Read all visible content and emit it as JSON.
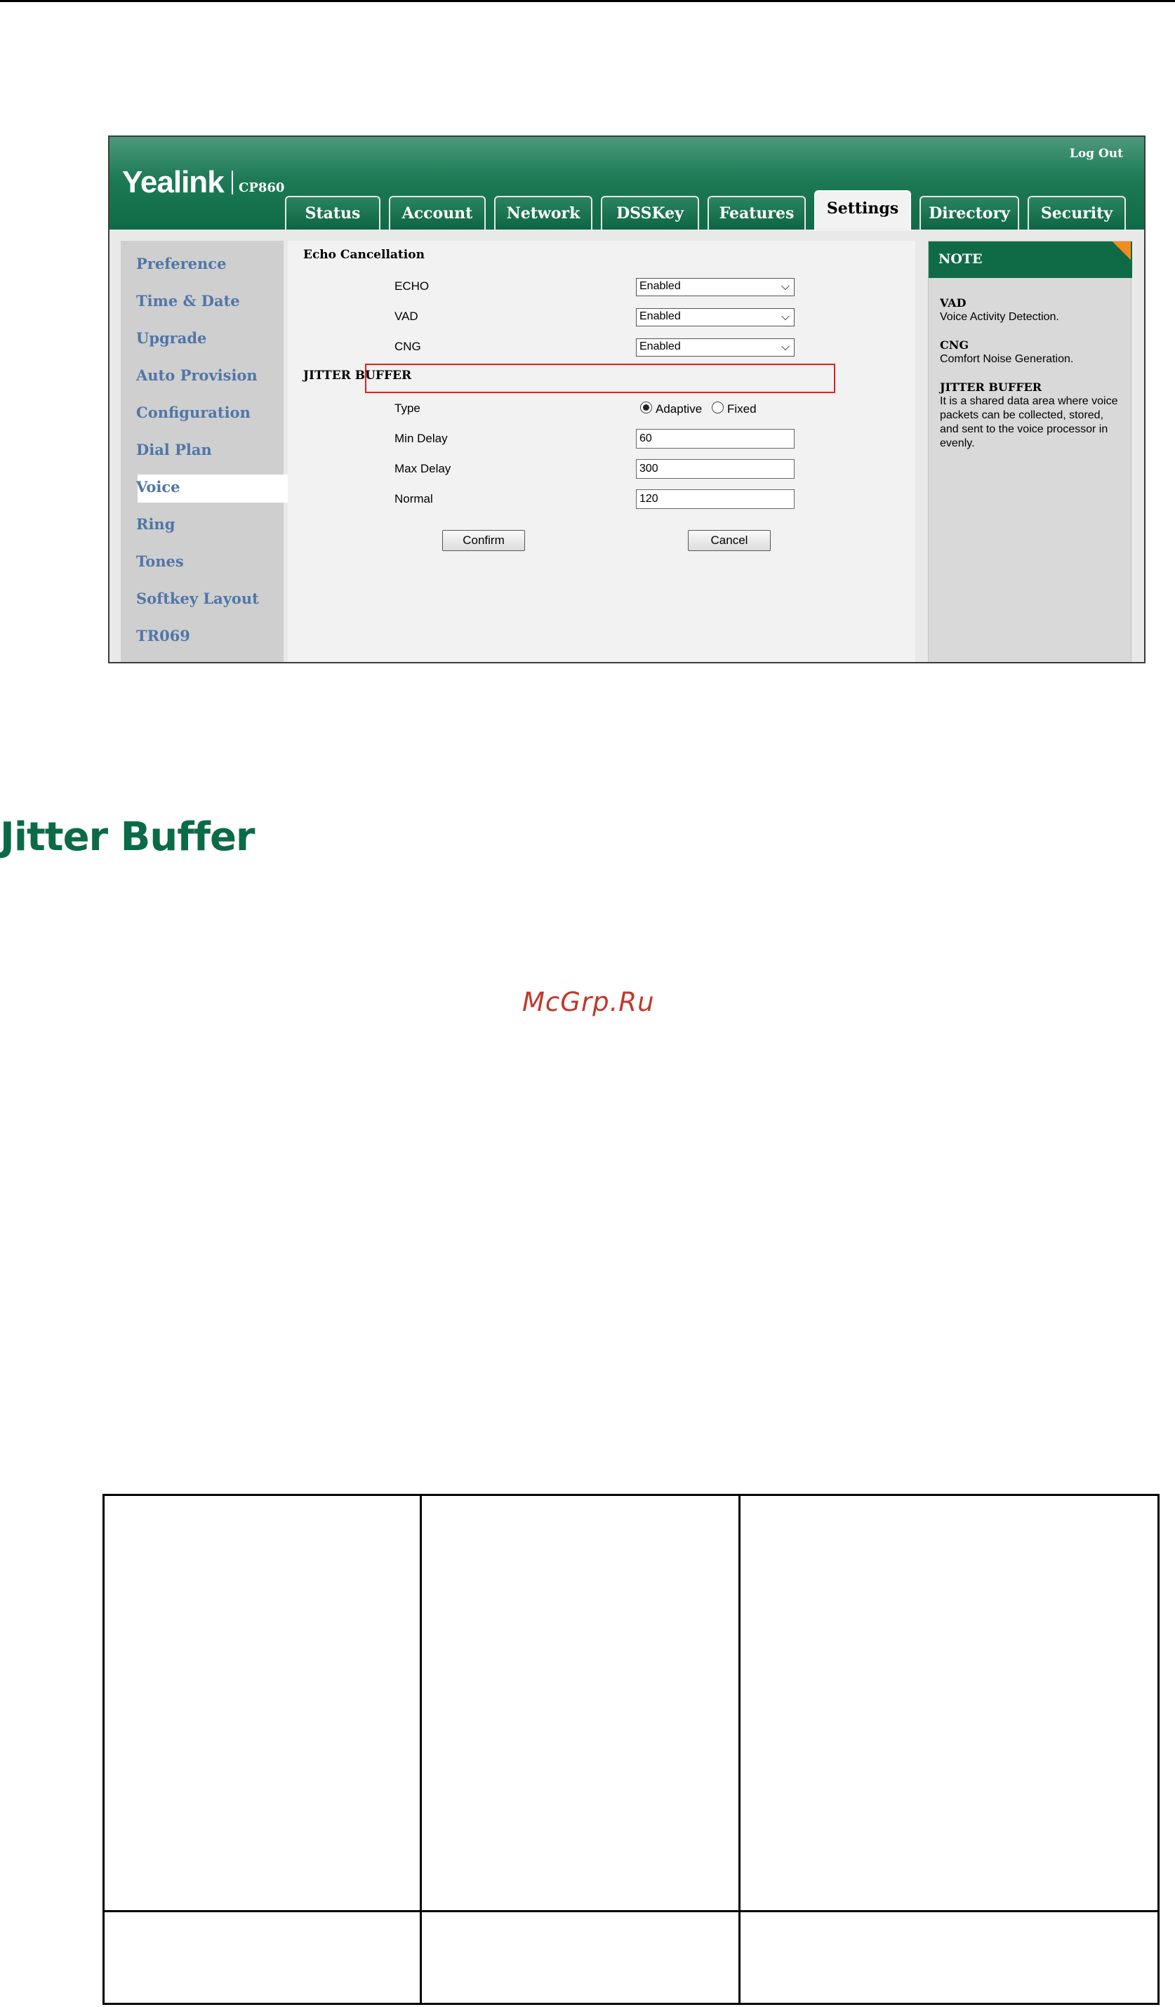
{
  "screenshot": {
    "brand": "Yealink",
    "model": "CP860",
    "logout": "Log Out",
    "tabs": [
      "Status",
      "Account",
      "Network",
      "DSSKey",
      "Features",
      "Settings",
      "Directory",
      "Security"
    ],
    "active_tab": "Settings",
    "sidebar": [
      "Preference",
      "Time & Date",
      "Upgrade",
      "Auto Provision",
      "Configuration",
      "Dial Plan",
      "Voice",
      "Ring",
      "Tones",
      "Softkey Layout",
      "TR069"
    ],
    "active_sidebar": "Voice",
    "echo_section": "Echo Cancellation",
    "echo_label": "ECHO",
    "echo_value": "Enabled",
    "vad_label": "VAD",
    "vad_value": "Enabled",
    "cng_label": "CNG",
    "cng_value": "Enabled",
    "jitter_section": "JITTER BUFFER",
    "type_label": "Type",
    "type_adaptive": "Adaptive",
    "type_fixed": "Fixed",
    "min_delay_label": "Min Delay",
    "min_delay_value": "60",
    "max_delay_label": "Max Delay",
    "max_delay_value": "300",
    "normal_label": "Normal",
    "normal_value": "120",
    "confirm": "Confirm",
    "cancel": "Cancel",
    "note": {
      "title": "NOTE",
      "vad_title": "VAD",
      "vad_text": "Voice Activity Detection.",
      "cng_title": "CNG",
      "cng_text": "Comfort Noise Generation.",
      "jb_title": "JITTER BUFFER",
      "jb_text": "It is a shared data area where voice packets can be collected, stored, and sent to the voice processor in evenly."
    }
  },
  "heading": "Jitter Buffer",
  "watermark": "McGrp.Ru"
}
